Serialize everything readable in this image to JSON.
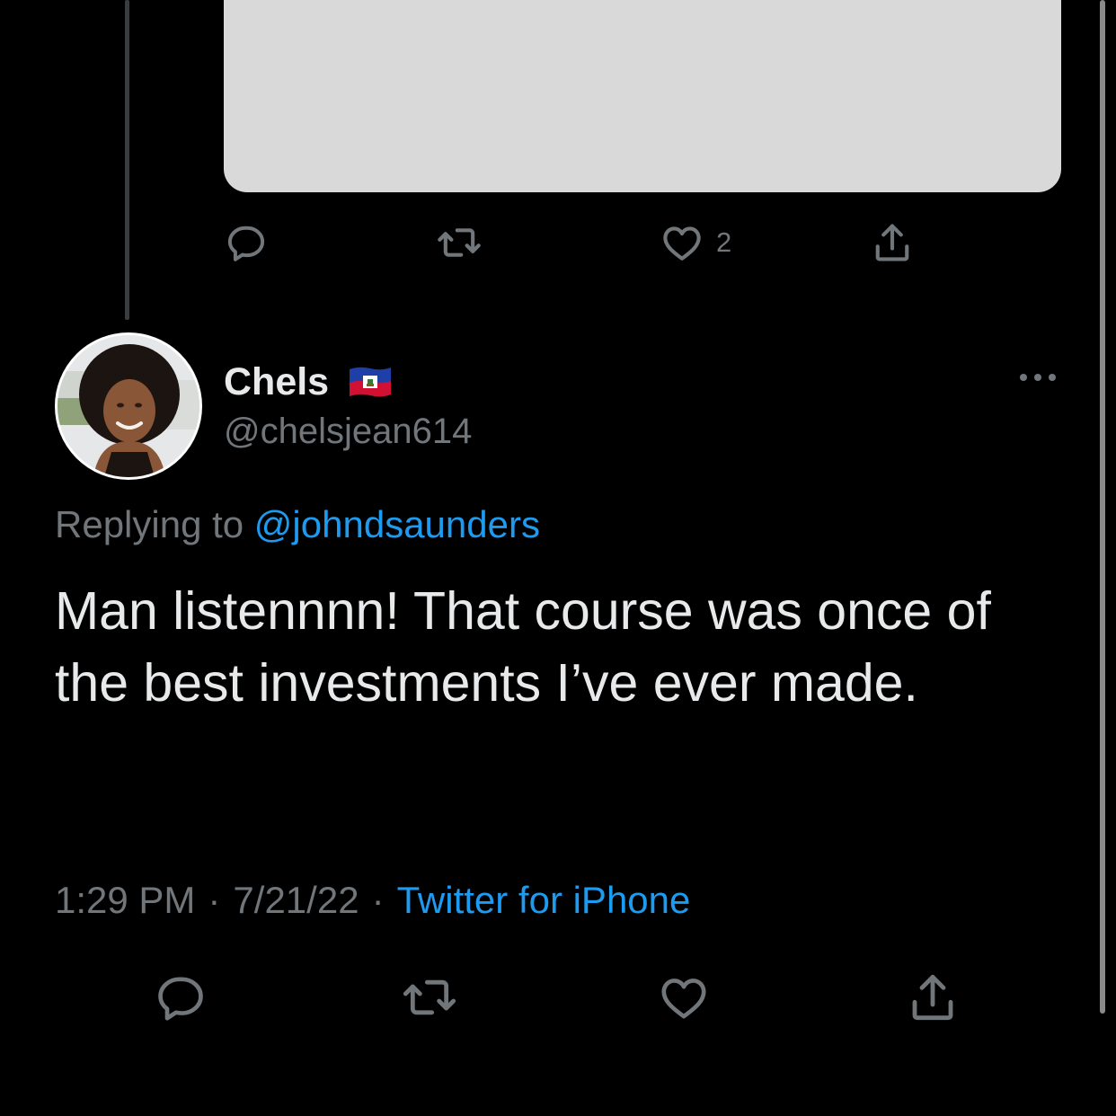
{
  "parent_tweet": {
    "actions": {
      "reply_icon": "reply-icon",
      "retweet_icon": "retweet-icon",
      "like_icon": "heart-icon",
      "like_count": "2",
      "share_icon": "share-icon"
    }
  },
  "tweet": {
    "author": {
      "display_name": "Chels",
      "flag_icon": "haiti-flag-icon",
      "handle": "@chelsjean614"
    },
    "more_icon": "more-options-icon",
    "replying_prefix": "Replying to ",
    "replying_to": "@johndsaunders",
    "text": "Man listennnn! That course was once of the best investments I’ve ever made.",
    "time": "1:29 PM",
    "separator_1": "·",
    "date": "7/21/22",
    "separator_2": "·",
    "source": "Twitter for iPhone",
    "actions": {
      "reply_icon": "reply-icon",
      "retweet_icon": "retweet-icon",
      "like_icon": "heart-icon",
      "share_icon": "share-icon"
    }
  },
  "colors": {
    "background": "#000000",
    "primary_text": "#e7e9ea",
    "secondary_text": "#71767b",
    "link_blue": "#1d9bf0",
    "media_placeholder": "#d9d9d9",
    "thread_line": "#3a3d40"
  }
}
